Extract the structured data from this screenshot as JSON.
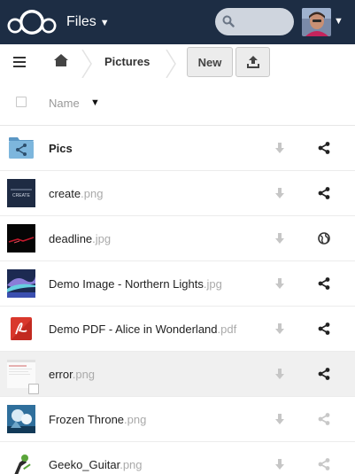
{
  "header": {
    "app_name": "Files",
    "search": {
      "value": "",
      "placeholder": ""
    }
  },
  "breadcrumb": {
    "current": "Pictures"
  },
  "toolbar": {
    "new_label": "New"
  },
  "table": {
    "name_column": "Name",
    "sort_indicator": "▼"
  },
  "files": [
    {
      "name": "Pics",
      "ext": "",
      "thumb": "folder-shared",
      "share": "shared"
    },
    {
      "name": "create",
      "ext": ".png",
      "thumb": "image-create",
      "share": "shared"
    },
    {
      "name": "deadline",
      "ext": ".jpg",
      "thumb": "image-deadline",
      "share": "public-link"
    },
    {
      "name": "Demo Image - Northern Lights",
      "ext": ".jpg",
      "thumb": "image-northern-lights",
      "share": "shared"
    },
    {
      "name": "Demo PDF - Alice in Wonderland",
      "ext": ".pdf",
      "thumb": "pdf",
      "share": "shared"
    },
    {
      "name": "error",
      "ext": ".png",
      "thumb": "image-error",
      "share": "shared",
      "selected": true
    },
    {
      "name": "Frozen Throne",
      "ext": ".png",
      "thumb": "image-frozen-throne",
      "share": "not-shared"
    },
    {
      "name": "Geeko_Guitar",
      "ext": ".png",
      "thumb": "image-geeko-guitar",
      "share": "not-shared"
    }
  ],
  "thumb_texts": {
    "create": "CREATE"
  },
  "colors": {
    "header_bg": "#1d2d44",
    "share_active": "#222222",
    "share_inactive": "#c8c8c8",
    "download": "#c6c6c6"
  }
}
